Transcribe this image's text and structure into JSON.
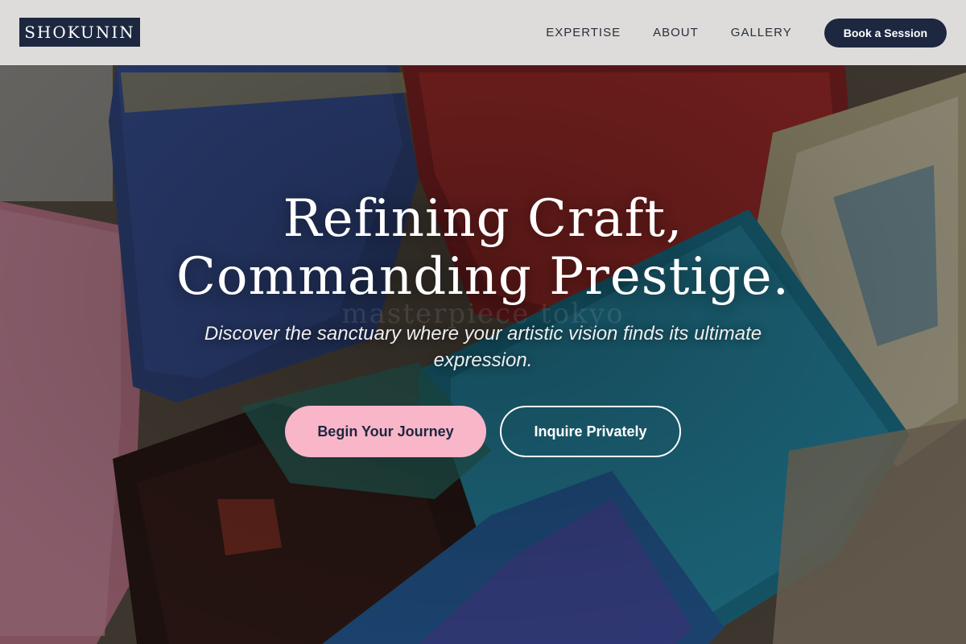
{
  "brand": {
    "logo_text": "SHOKUNIN"
  },
  "nav": {
    "links": [
      {
        "label": "EXPERTISE"
      },
      {
        "label": "ABOUT"
      },
      {
        "label": "GALLERY"
      }
    ],
    "cta_label": "Book a Session"
  },
  "hero": {
    "title_line_1": "Refining Craft,",
    "title_line_2": "Commanding Prestige.",
    "subtitle": "Discover the sanctuary where your artistic vision finds its ultimate expression.",
    "watermark_text": "masterpiece tokyo",
    "primary_button_label": "Begin Your Journey",
    "secondary_button_label": "Inquire Privately"
  },
  "colors": {
    "navy": "#1d2740",
    "pink_accent": "#f8b6c8",
    "nav_background": "#ecEAE9"
  },
  "background": {
    "image_subject": "paint-brushes-image"
  }
}
